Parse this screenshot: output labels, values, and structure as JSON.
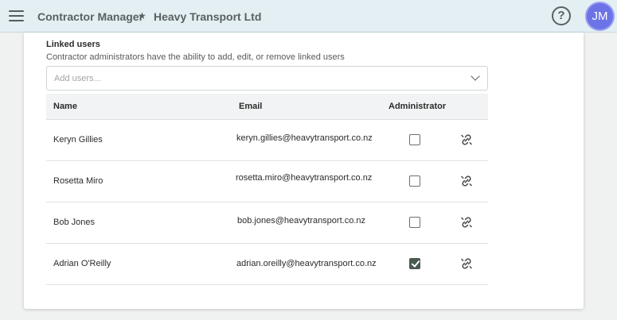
{
  "header": {
    "app_title": "Contractor Manager",
    "separator": "★",
    "company": "Heavy Transport Ltd",
    "help_symbol": "?",
    "avatar_initials": "JM",
    "colors": {
      "bar": "#e3eff3",
      "avatar": "#6b73e6"
    }
  },
  "linked_users": {
    "title": "Linked users",
    "description": "Contractor administrators have the ability to add, edit, or remove linked users",
    "add_placeholder": "Add users...",
    "columns": {
      "name": "Name",
      "email": "Email",
      "administrator": "Administrator"
    },
    "rows": [
      {
        "name": "Keryn Gillies",
        "email": "keryn.gillies@heavytransport.co.nz",
        "administrator": false
      },
      {
        "name": "Rosetta Miro",
        "email": "rosetta.miro@heavytransport.co.nz",
        "administrator": false
      },
      {
        "name": "Bob Jones",
        "email": "bob.jones@heavytransport.co.nz",
        "administrator": false
      },
      {
        "name": "Adrian O'Reilly",
        "email": "adrian.oreilly@heavytransport.co.nz",
        "administrator": true
      }
    ]
  },
  "icons": {
    "menu": "hamburger-menu-icon",
    "help": "help-circle-icon",
    "dropdown": "chevron-down-icon",
    "unlink": "unlink-icon"
  }
}
